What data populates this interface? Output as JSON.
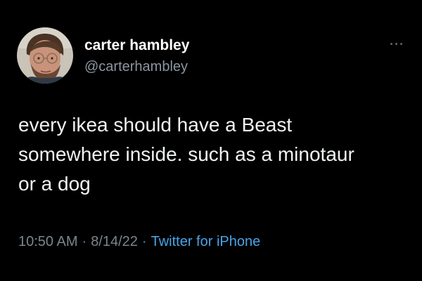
{
  "author": {
    "display_name": "carter hambley",
    "handle": "@carterhambley",
    "avatar_icon": "profile-photo"
  },
  "more_icon": "more-options-icon",
  "tweet": {
    "lines": [
      "every ikea should have a Beast",
      "somewhere inside. such as a minotaur",
      "or a dog"
    ]
  },
  "meta": {
    "time": "10:50 AM",
    "separator": "·",
    "date": "8/14/22",
    "source": "Twitter for iPhone"
  },
  "colors": {
    "background": "#000000",
    "name": "#ffffff",
    "secondary": "#7b858e",
    "link": "#4aa3e8"
  }
}
